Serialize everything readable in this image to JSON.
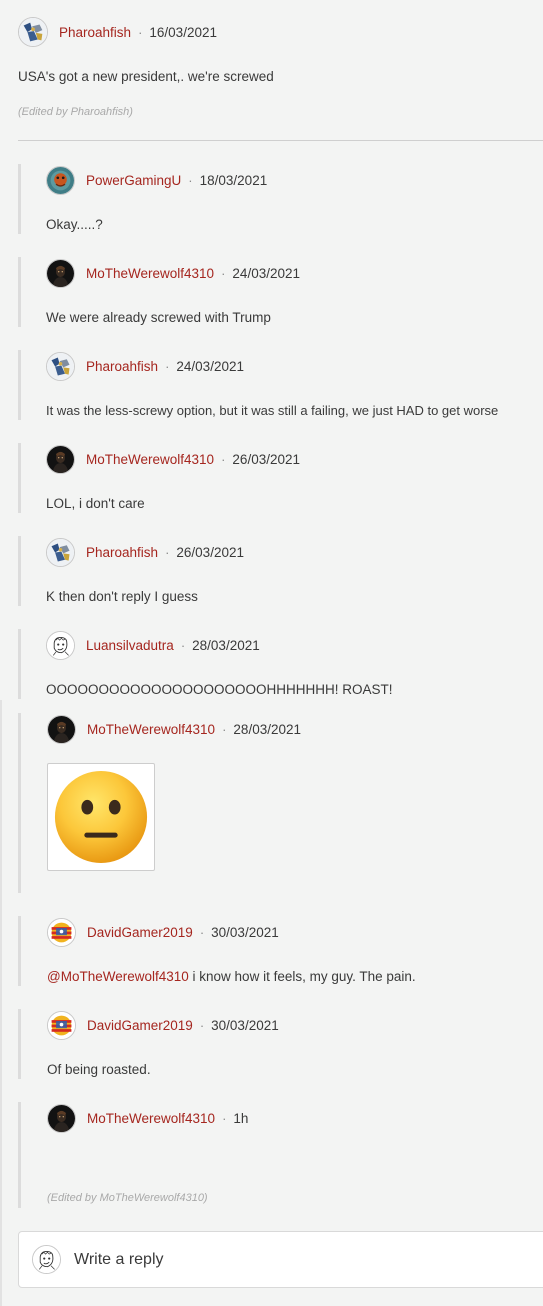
{
  "original": {
    "user": "Pharoahfish",
    "date": "16/03/2021",
    "text": "USA's got a new president,. we're screwed",
    "edited": "(Edited by Pharoahfish)"
  },
  "separator": "·",
  "replies": [
    {
      "user": "PowerGamingU",
      "date": "18/03/2021",
      "text": "Okay.....?"
    },
    {
      "user": "MoTheWerewolf4310",
      "date": "24/03/2021",
      "text": "We were already screwed with Trump"
    },
    {
      "user": "Pharoahfish",
      "date": "24/03/2021",
      "text": "It was the less-screwy option, but it was still a failing, we just HAD to get worse"
    },
    {
      "user": "MoTheWerewolf4310",
      "date": "26/03/2021",
      "text": "LOL, i don't care"
    },
    {
      "user": "Pharoahfish",
      "date": "26/03/2021",
      "text": "K then don't reply I guess"
    },
    {
      "user": "Luansilvadutra",
      "date": "28/03/2021",
      "text": "OOOOOOOOOOOOOOOOOOOOOHHHHHHH! ROAST!"
    },
    {
      "user": "MoTheWerewolf4310",
      "date": "28/03/2021",
      "image": "neutral-face-emoji"
    },
    {
      "user": "DavidGamer2019",
      "date": "30/03/2021",
      "mention": "@MoTheWerewolf4310",
      "text": " i know how it feels, my guy. The pain."
    },
    {
      "user": "DavidGamer2019",
      "date": "30/03/2021",
      "text": "Of being roasted."
    },
    {
      "user": "MoTheWerewolf4310",
      "date": "1h",
      "text": "",
      "edited": "(Edited by MoTheWerewolf4310)"
    }
  ],
  "reply_box": {
    "placeholder": "Write a reply"
  },
  "colors": {
    "username": "#a5261f",
    "background": "#f3f4f3",
    "rail": "#dcdcdc"
  }
}
